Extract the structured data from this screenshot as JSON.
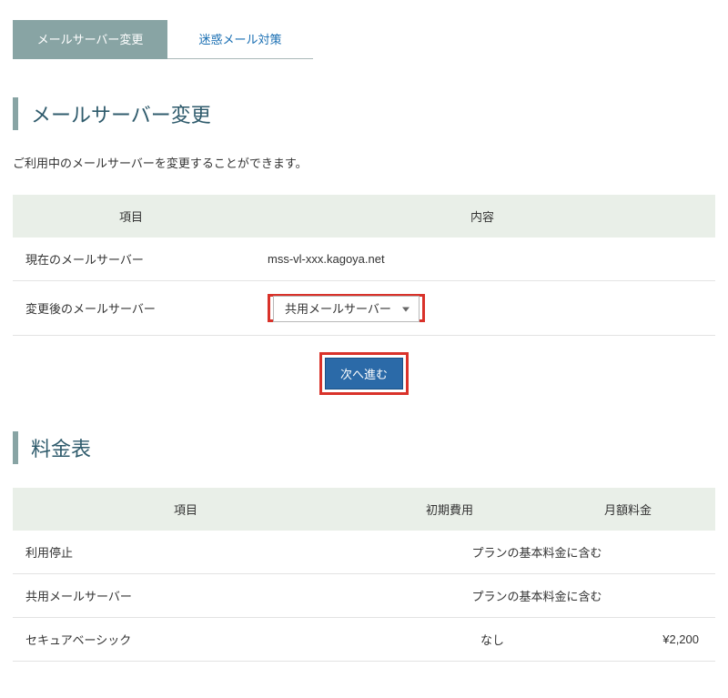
{
  "tabs": {
    "active": "メールサーバー変更",
    "inactive": "迷惑メール対策"
  },
  "heading1": "メールサーバー変更",
  "desc1": "ご利用中のメールサーバーを変更することができます。",
  "settings_table": {
    "header_item": "項目",
    "header_content": "内容",
    "row1_label": "現在のメールサーバー",
    "row1_value": "mss-vl-xxx.kagoya.net",
    "row2_label": "変更後のメールサーバー",
    "select_value": "共用メールサーバー"
  },
  "next_button": "次へ進む",
  "heading2": "料金表",
  "fees_table": {
    "header_item": "項目",
    "header_initcost": "初期費用",
    "header_monthly": "月額料金",
    "rows": [
      {
        "label": "利用停止",
        "merged": "プランの基本料金に含む"
      },
      {
        "label": "共用メールサーバー",
        "merged": "プランの基本料金に含む"
      },
      {
        "label": "セキュアベーシック",
        "initcost": "なし",
        "monthly": "¥2,200"
      }
    ]
  }
}
